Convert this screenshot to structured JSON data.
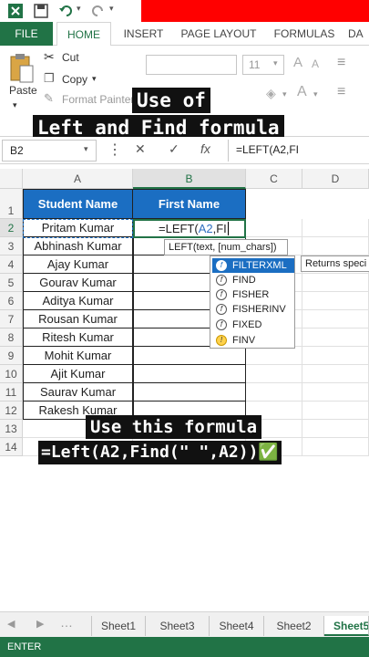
{
  "tabs": {
    "file": "FILE",
    "home": "HOME",
    "insert": "INSERT",
    "page_layout": "PAGE LAYOUT",
    "formulas": "FORMULAS",
    "data": "DA"
  },
  "ribbon": {
    "paste": "Paste",
    "cut": "Cut",
    "copy": "Copy",
    "format_painter": "Format Painter",
    "font_size": "11",
    "align_label": "A"
  },
  "captions": {
    "top_line1": "Use of",
    "top_line2": "Left and Find formula",
    "mid_line1": "Use this formula",
    "mid_line2": "=Left(A2,Find(\" \",A2))✅"
  },
  "formula_bar": {
    "name_box": "B2",
    "cancel": "✕",
    "enter": "✓",
    "fx": "fx",
    "content": "=LEFT(A2,FI"
  },
  "columns": [
    "A",
    "B",
    "C",
    "D"
  ],
  "rows": [
    "1",
    "2",
    "3",
    "4",
    "5",
    "6",
    "7",
    "8",
    "9",
    "10",
    "11",
    "12",
    "13",
    "14"
  ],
  "headers": {
    "student_name": "Student Name",
    "first_name": "First Name"
  },
  "students": [
    "Pritam Kumar",
    "Abhinash Kumar",
    "Ajay Kumar",
    "Gourav Kumar",
    "Aditya Kumar",
    "Rousan Kumar",
    "Ritesh Kumar",
    "Mohit Kumar",
    "Ajit Kumar",
    "Saurav Kumar",
    "Rakesh Kumar"
  ],
  "editing_cell": {
    "prefix": "=LEFT(",
    "ref": "A2",
    "suffix": ",FI"
  },
  "tooltip": "LEFT(text, [num_chars])",
  "autocomplete": [
    "FILTERXML",
    "FIND",
    "FISHER",
    "FISHERINV",
    "FIXED",
    "FINV"
  ],
  "description": "Returns speci",
  "sheets": [
    "Sheet1",
    "Sheet3",
    "Sheet4",
    "Sheet2",
    "Sheet5"
  ],
  "status": "ENTER",
  "colors": {
    "excel_green": "#217346",
    "header_blue": "#1b6ec2",
    "red_bar": "#ff0000"
  }
}
